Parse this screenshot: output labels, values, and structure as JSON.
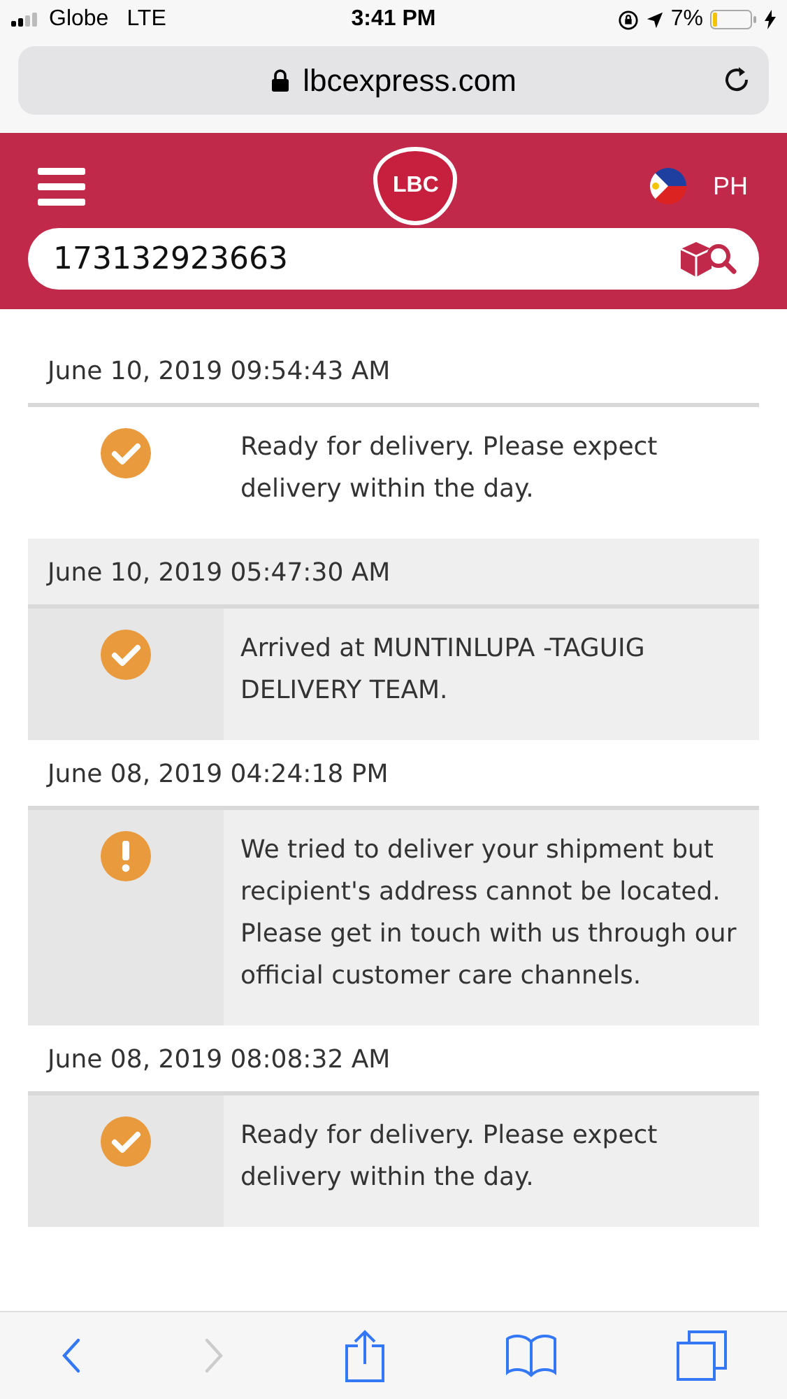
{
  "status_bar": {
    "carrier": "Globe",
    "network": "LTE",
    "time": "3:41 PM",
    "battery_percent": "7%"
  },
  "address_bar": {
    "url": "lbcexpress.com"
  },
  "header": {
    "logo": "LBC",
    "country": "PH"
  },
  "search": {
    "value": "173132923663"
  },
  "events": [
    {
      "datetime": "June 10, 2019 09:54:43 AM",
      "header_shaded": false,
      "body_shaded": false,
      "kind": "check",
      "message": "Ready for delivery. Please expect delivery within the day."
    },
    {
      "datetime": "June 10, 2019 05:47:30 AM",
      "header_shaded": true,
      "body_shaded": true,
      "kind": "check",
      "message": "Arrived at MUNTINLUPA -TAGUIG DELIVERY TEAM."
    },
    {
      "datetime": "June 08, 2019 04:24:18 PM",
      "header_shaded": false,
      "body_shaded": true,
      "kind": "alert",
      "message": "We tried to deliver your shipment but recipient's address cannot be located. Please get in touch with us through our official customer care channels."
    },
    {
      "datetime": "June 08, 2019 08:08:32 AM",
      "header_shaded": false,
      "body_shaded": true,
      "kind": "check",
      "message": "Ready for delivery. Please expect delivery within the day."
    }
  ],
  "toolbar": {
    "back_disabled": false,
    "forward_disabled": true
  }
}
